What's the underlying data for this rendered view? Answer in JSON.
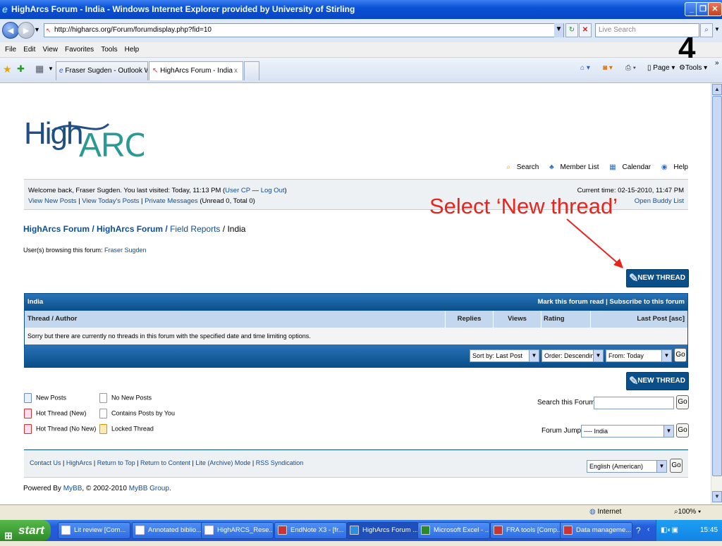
{
  "window": {
    "title": "HighArcs Forum - India - Windows Internet Explorer provided by University of Stirling"
  },
  "address": {
    "url": "http://higharcs.org/Forum/forumdisplay.php?fid=10",
    "search_placeholder": "Live Search"
  },
  "menu": [
    "File",
    "Edit",
    "View",
    "Favorites",
    "Tools",
    "Help"
  ],
  "slide_number": "4",
  "tabs": [
    {
      "label": "Fraser Sugden - Outlook We..."
    },
    {
      "label": "HighArcs Forum - India"
    }
  ],
  "toolbar": {
    "page": "Page",
    "tools": "Tools"
  },
  "site": {
    "logo_text": "HighARCS",
    "top_links": {
      "search": "Search",
      "member_list": "Member List",
      "calendar": "Calendar",
      "help": "Help"
    },
    "welcome": {
      "line1_prefix": "Welcome back, Fraser Sugden. You last visited: Today, 11:13 PM (",
      "user_cp": "User CP",
      "dash": " — ",
      "logout": "Log Out",
      "line1_suffix": ")",
      "view_new_posts": "View New Posts",
      "view_todays_posts": "View Today's Posts",
      "private_messages": "Private Messages",
      "pm_counts": "(Unread 0, Total 0)",
      "current_time": "Current time: 02-15-2010, 11:47 PM",
      "open_buddy_list": "Open Buddy List"
    },
    "breadcrumb": {
      "b1": "HighArcs Forum",
      "sep": " / ",
      "b2": "HighArcs Forum",
      "b3": "Field Reports",
      "current": "India"
    },
    "browsing": {
      "prefix": "User(s) browsing this forum: ",
      "user": "Fraser Sugden"
    },
    "new_thread_label": "NEW THREAD",
    "forum_table": {
      "title": "India",
      "mark_read": "Mark this forum read",
      "separator": " | ",
      "subscribe": "Subscribe to this forum",
      "columns": {
        "thread": "Thread / Author",
        "replies": "Replies",
        "views": "Views",
        "rating": "Rating",
        "last_post": "Last Post [asc]"
      },
      "empty_message": "Sorry but there are currently no threads in this forum with the specified date and time limiting options.",
      "sort_by": "Sort by: Last Post",
      "order": "Order: Descending",
      "from": "From: Today",
      "go": "Go"
    },
    "legend": {
      "new_posts": "New Posts",
      "no_new_posts": "No New Posts",
      "hot_new": "Hot Thread (New)",
      "contains_posts": "Contains Posts by You",
      "hot_no_new": "Hot Thread (No New)",
      "locked": "Locked Thread"
    },
    "search_forum_label": "Search this Forum:",
    "forum_jump_label": "Forum Jump:",
    "forum_jump_value": "---- India",
    "footer": {
      "links": [
        "Contact Us",
        "HighArcs",
        "Return to Top",
        "Return to Content",
        "Lite (Archive) Mode",
        "RSS Syndication"
      ],
      "language": "English (American)"
    },
    "powered_by": {
      "prefix": "Powered By ",
      "mybb": "MyBB",
      "copy": ", © 2002-2010 ",
      "group": "MyBB Group",
      "end": "."
    }
  },
  "annotation": "Select ‘New thread’",
  "status": {
    "zone": "Internet",
    "zoom": "100%"
  },
  "taskbar": {
    "start": "start",
    "items": [
      "Lit review [Com...",
      "Annotated biblio...",
      "HighARCS_Rese...",
      "EndNote X3 - [fr...",
      "HighArcs Forum ...",
      "Microsoft Excel - ...",
      "FRA tools [Comp...",
      "Data manageme..."
    ],
    "clock": "15:45"
  }
}
